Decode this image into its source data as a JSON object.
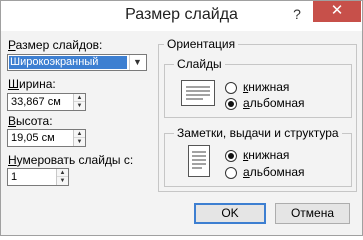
{
  "window": {
    "title": "Размер слайда",
    "help_glyph": "?",
    "close_glyph": "✕"
  },
  "slide_size": {
    "label_prefix": "Р",
    "label_rest": "азмер слайдов:",
    "value": "Широкоэкранный",
    "arrow": "▼"
  },
  "width": {
    "label_prefix": "Ш",
    "label_rest": "ирина:",
    "value": "33,867 см"
  },
  "height": {
    "label_prefix": "В",
    "label_rest": "ысота:",
    "value": "19,05 см"
  },
  "numbering": {
    "label_prefix": "Н",
    "label_rest": "умеровать слайды с:",
    "value": "1"
  },
  "spinner": {
    "up": "▲",
    "down": "▼"
  },
  "orientation": {
    "title": "Ориентация",
    "slides": {
      "title": "Слайды",
      "options": [
        {
          "label_prefix": "к",
          "label_rest": "нижная",
          "checked": false
        },
        {
          "label_prefix": "а",
          "label_rest": "льбомная",
          "checked": true
        }
      ]
    },
    "notes": {
      "title": "Заметки, выдачи и структура",
      "options": [
        {
          "label_prefix": "к",
          "label_rest": "нижная",
          "checked": true
        },
        {
          "label_prefix": "а",
          "label_rest": "льбомная",
          "checked": false
        }
      ]
    }
  },
  "buttons": {
    "ok": "OK",
    "cancel": "Отмена"
  },
  "colors": {
    "selection": "#3d7fd1",
    "close": "#c7504a",
    "dialog_bg": "#f3f3f3"
  }
}
